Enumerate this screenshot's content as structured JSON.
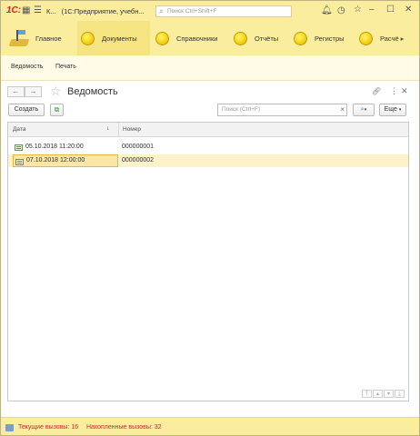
{
  "titlebar": {
    "logo": "1С:",
    "short_title": "К...",
    "title": "(1С:Предприятие, учебн...",
    "search_placeholder": "Поиск Ctrl+Shift+F",
    "icons": [
      "grid-icon",
      "menu-icon",
      "bell-icon",
      "history-icon",
      "star-icon",
      "minimize-icon",
      "maximize-icon",
      "close-icon"
    ]
  },
  "sections": [
    {
      "label": "Главное",
      "icon": "home-icon"
    },
    {
      "label": "Документы",
      "icon": "coin-icon",
      "active": true
    },
    {
      "label": "Справочники",
      "icon": "coin-icon"
    },
    {
      "label": "Отчёты",
      "icon": "coin-icon"
    },
    {
      "label": "Регистры",
      "icon": "coin-icon"
    },
    {
      "label": "Расчё",
      "icon": "coin-icon"
    }
  ],
  "commands": [
    "Ведомость",
    "Печать"
  ],
  "form": {
    "title": "Ведомость",
    "create_label": "Создать",
    "search_placeholder": "Поиск (Ctrl+F)",
    "more_label": "Еще",
    "columns": [
      "Дата",
      "Номер"
    ],
    "rows": [
      {
        "date": "05.10.2018 11:20:00",
        "number": "000000001"
      },
      {
        "date": "07.10.2018 12:00:00",
        "number": "000000002",
        "selected": true
      }
    ]
  },
  "status": {
    "current_calls": "Текущие вызовы: 16",
    "accumulated_calls": "Накопленные вызовы: 32"
  },
  "colors": {
    "panel_bg": "#fbed9e",
    "selected_row": "#fdf2c8",
    "selected_cell_border": "#e6b73c",
    "status_text": "#d0282c",
    "logo": "#d6231e"
  }
}
